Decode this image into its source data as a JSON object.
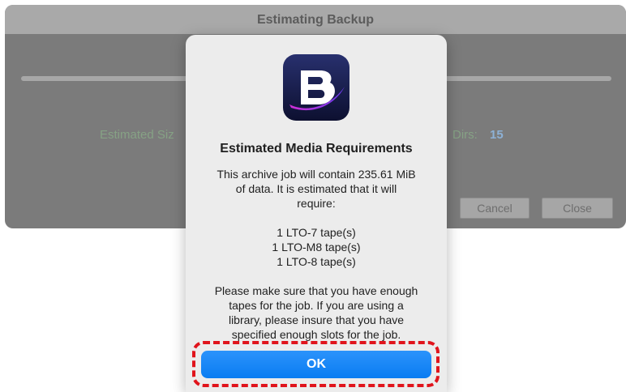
{
  "background_window": {
    "title": "Estimating Backup",
    "estimated_size_label": "Estimated Siz",
    "dirs_label": "Dirs:",
    "dirs_value": "15",
    "cancel_label": "Cancel",
    "close_label": "Close"
  },
  "alert": {
    "icon": "bru-app-icon",
    "title": "Estimated Media Requirements",
    "intro_lines": [
      "This archive job will contain 235.61 MiB",
      "of data.  It is estimated that it will",
      "require:"
    ],
    "tape_lines": [
      "1 LTO-7 tape(s)",
      "1 LTO-M8 tape(s)",
      "1 LTO-8 tape(s)"
    ],
    "note_lines": [
      "Please make sure that you have enough",
      "tapes for the job.  If you are using a",
      "library, please insure that you have",
      "specified enough slots for the job."
    ],
    "ok_label": "OK"
  },
  "colors": {
    "ok_button": "#1a86f8",
    "highlight_border": "#e0141c",
    "dirs_value": "#8db1d6"
  }
}
